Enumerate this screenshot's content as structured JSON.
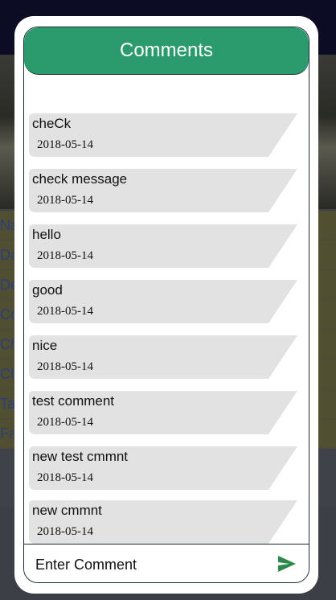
{
  "background": {
    "rows": [
      "Na",
      "Da",
      "De",
      "Co",
      "Ch",
      "Ch",
      "Ta",
      "Fa"
    ]
  },
  "dialog": {
    "title": "Comments",
    "comments": [
      {
        "text": "cheCk",
        "date": "2018-05-14"
      },
      {
        "text": "check message",
        "date": "2018-05-14"
      },
      {
        "text": "hello",
        "date": "2018-05-14"
      },
      {
        "text": "good",
        "date": "2018-05-14"
      },
      {
        "text": "nice",
        "date": "2018-05-14"
      },
      {
        "text": "test comment",
        "date": "2018-05-14"
      },
      {
        "text": "new test cmmnt",
        "date": "2018-05-14"
      },
      {
        "text": "new cmmnt",
        "date": "2018-05-14"
      }
    ],
    "input_placeholder": "Enter Comment",
    "send_icon": "send-icon"
  },
  "colors": {
    "header": "#2b9a6c",
    "bubble": "#e2e2e2",
    "send": "#2b8a4a"
  }
}
